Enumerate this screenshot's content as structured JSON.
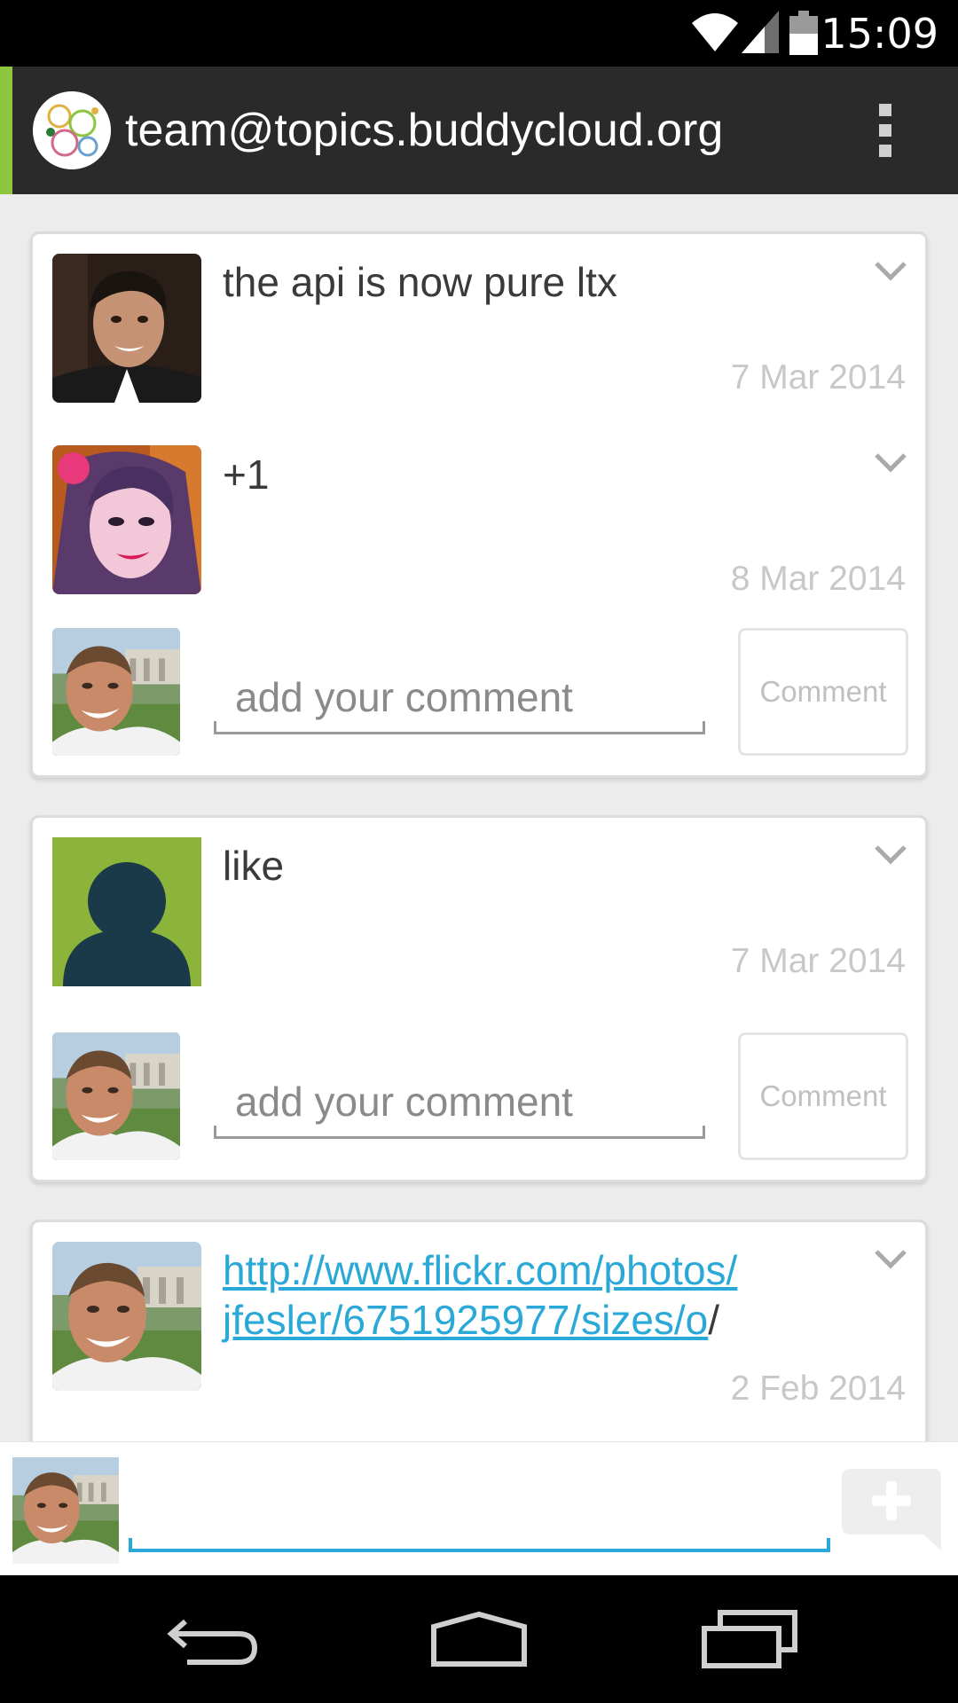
{
  "status_bar": {
    "time": "15:09",
    "icons": [
      "wifi-icon",
      "cell-signal-icon",
      "battery-icon"
    ]
  },
  "action_bar": {
    "title": "team@topics.buddycloud.org",
    "icons": [
      "channel-avatar-icon",
      "overflow-menu-icon"
    ],
    "accent_color": "#8cc63f"
  },
  "threads": [
    {
      "posts": [
        {
          "text": "the api is now pure ltx",
          "date": "7 Mar 2014"
        },
        {
          "text": "+1",
          "date": "8 Mar 2014"
        }
      ],
      "comment_placeholder": "add your comment",
      "comment_button": "Comment"
    },
    {
      "posts": [
        {
          "text": "like",
          "date": "7 Mar 2014"
        }
      ],
      "comment_placeholder": "add your comment",
      "comment_button": "Comment"
    },
    {
      "posts": [
        {
          "link_line1": "http://www.flickr.com/photos/",
          "link_line2": "jfesler/6751925977/sizes/o",
          "link_suffix": "/",
          "date": "2 Feb 2014"
        }
      ]
    }
  ],
  "compose": {
    "icons": [
      "user-avatar",
      "new-post-icon"
    ],
    "accent_color": "#2aa8d8"
  },
  "nav_bar": {
    "icons": [
      "back-icon",
      "home-icon",
      "recent-apps-icon"
    ]
  },
  "colors": {
    "link": "#2aa8d8",
    "date": "#c8c8c8",
    "background": "#ececec"
  }
}
